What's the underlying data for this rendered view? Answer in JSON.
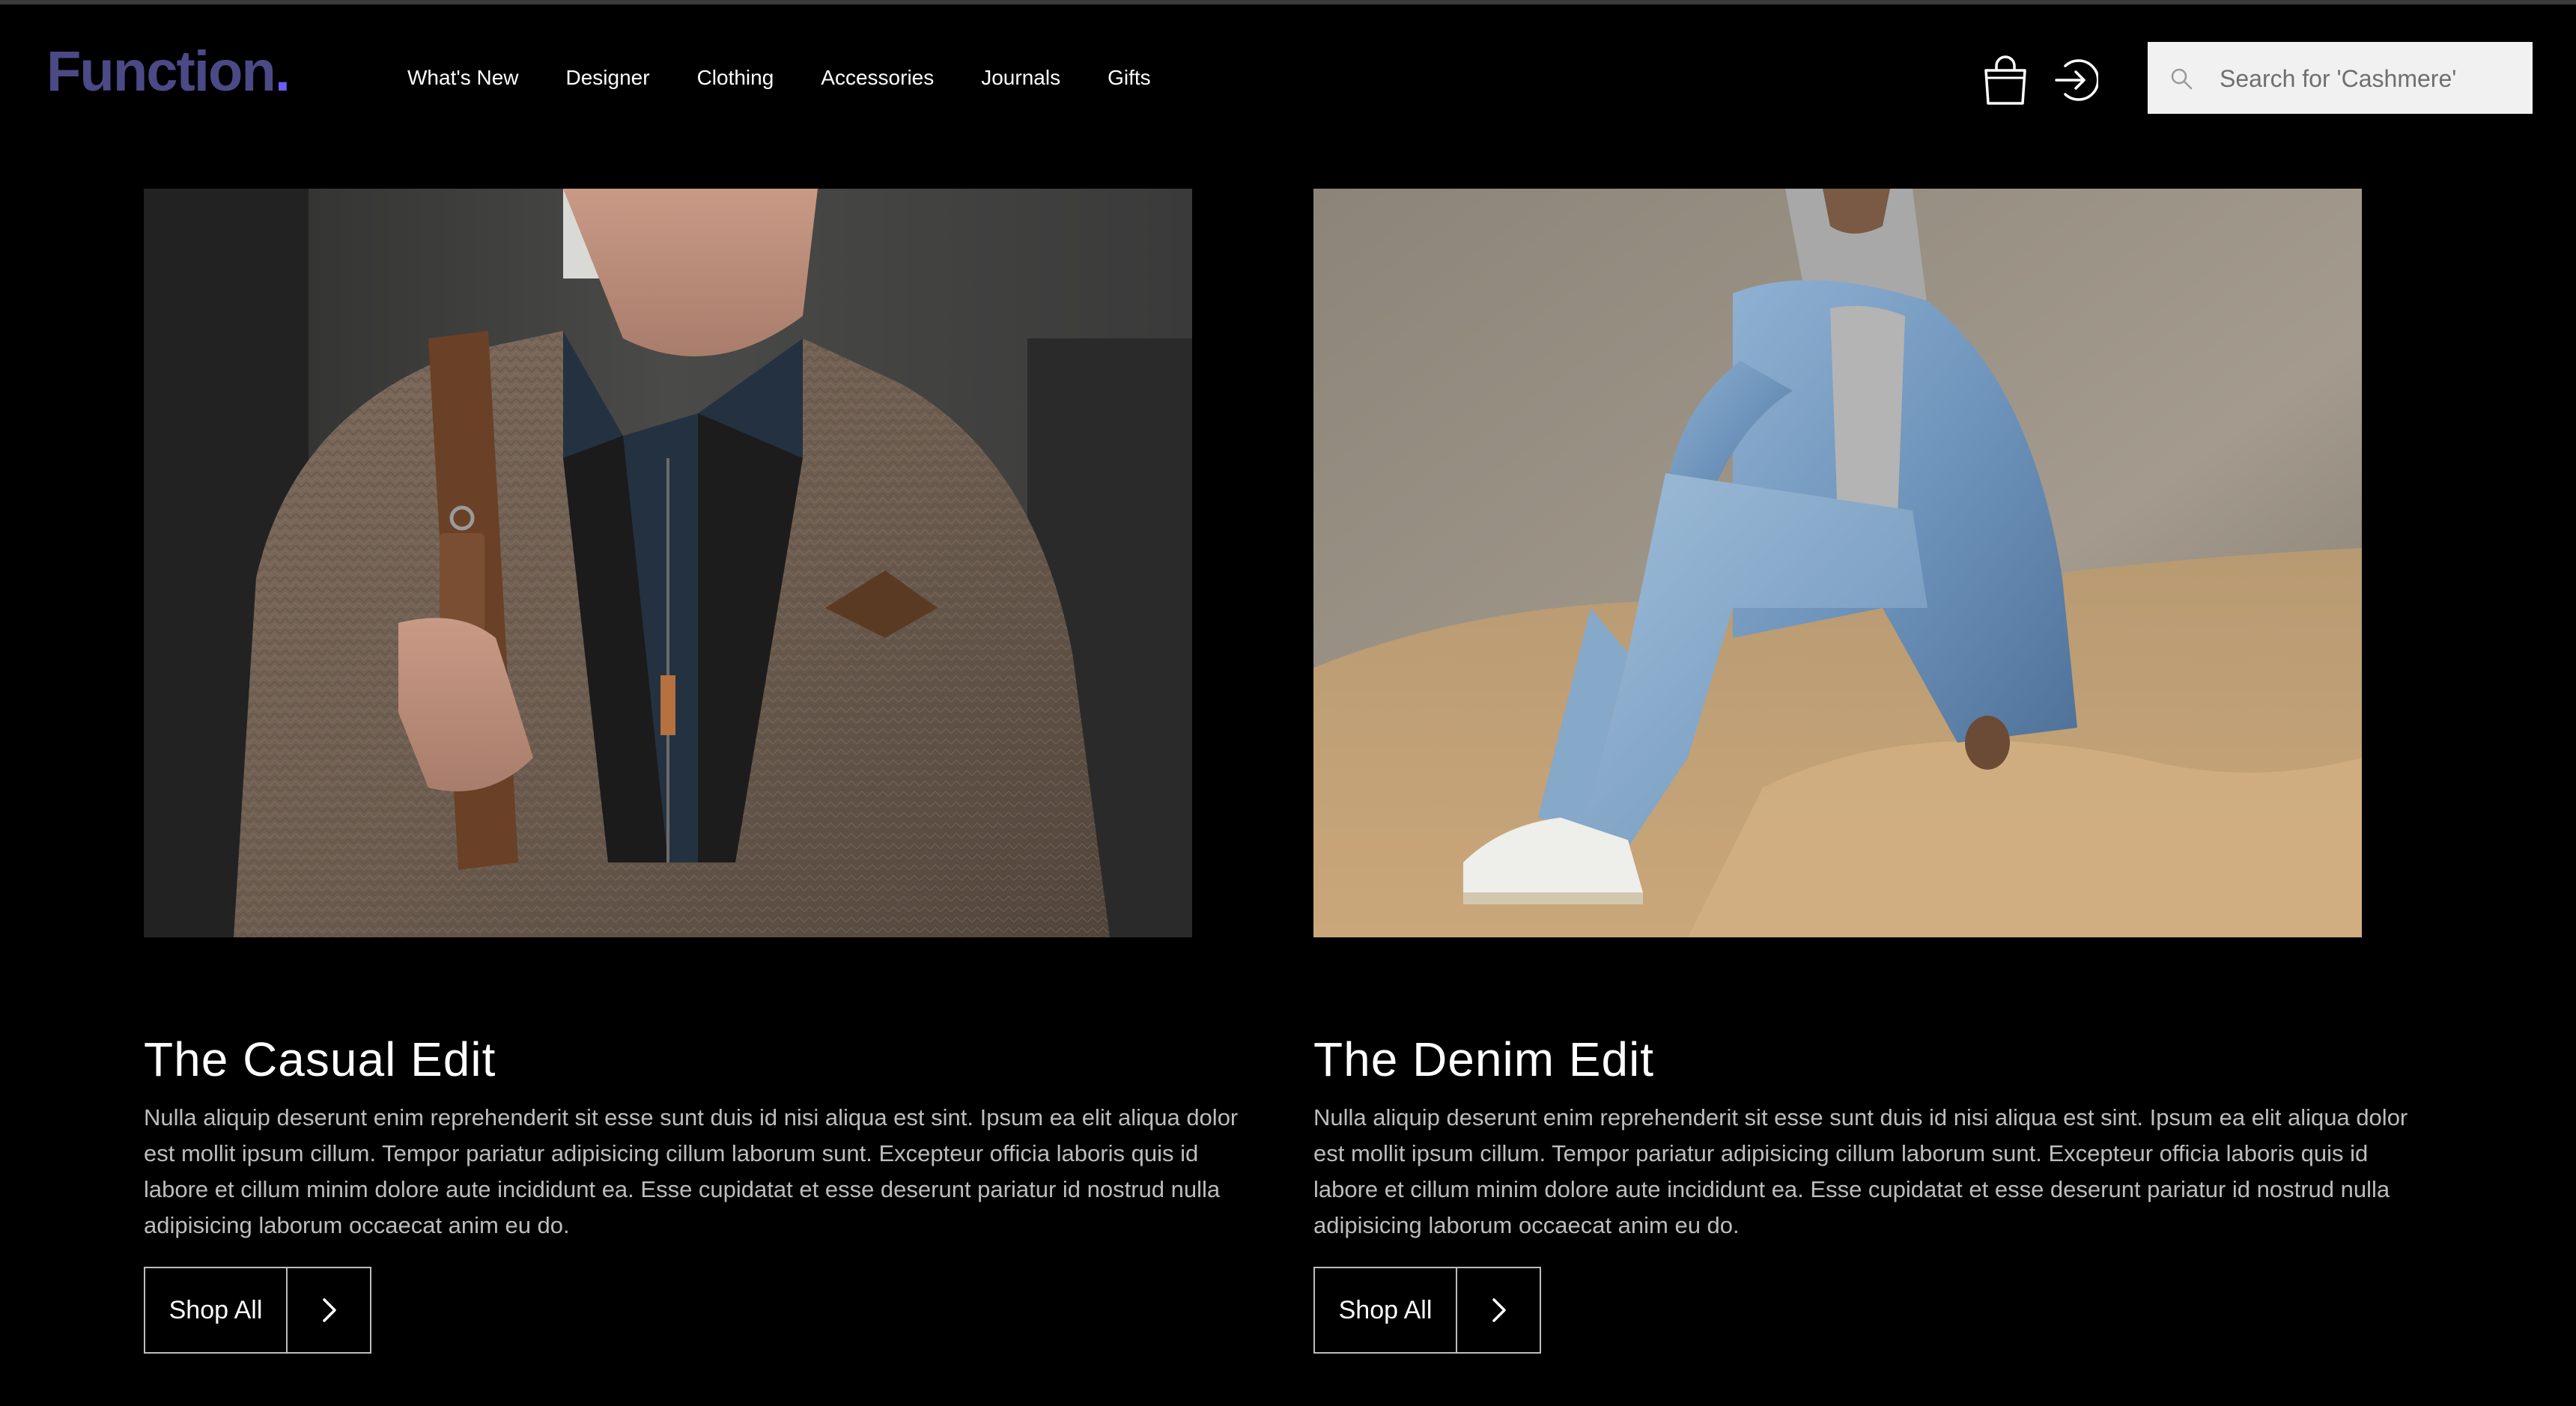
{
  "header": {
    "logo_text": "Function",
    "logo_dot": ".",
    "nav": [
      {
        "label": "What's New"
      },
      {
        "label": "Designer"
      },
      {
        "label": "Clothing"
      },
      {
        "label": "Accessories"
      },
      {
        "label": "Journals"
      },
      {
        "label": "Gifts"
      }
    ],
    "search": {
      "placeholder": "Search for 'Cashmere'",
      "value": ""
    }
  },
  "cards": [
    {
      "title": "The Casual Edit",
      "body": "Nulla aliquip deserunt enim reprehenderit sit esse sunt duis id nisi aliqua est sint. Ipsum ea elit aliqua dolor est mollit ipsum cillum. Tempor pariatur adipisicing cillum laborum sunt. Excepteur officia laboris quis id labore et cillum minim dolore aute incididunt ea. Esse cupidatat et esse deserunt pariatur id nostrud nulla adipisicing laborum occaecat anim eu do.",
      "button_label": "Shop All"
    },
    {
      "title": "The Denim Edit",
      "body": "Nulla aliquip deserunt enim reprehenderit sit esse sunt duis id nisi aliqua est sint. Ipsum ea elit aliqua dolor est mollit ipsum cillum. Tempor pariatur adipisicing cillum laborum sunt. Excepteur officia laboris quis id labore et cillum minim dolore aute incididunt ea. Esse cupidatat et esse deserunt pariatur id nostrud nulla adipisicing laborum occaecat anim eu do.",
      "button_label": "Shop All"
    }
  ],
  "colors": {
    "background": "#000000",
    "logo": "#4b4a86",
    "logo_dot": "#6d5cf6",
    "body_text": "#bdbdbd",
    "search_bg": "#f1f1f1"
  },
  "icons": {
    "cart": "shopping-bag-icon",
    "sign_in": "sign-in-arrow-icon",
    "search": "search-icon",
    "button_arrow": "chevron-right-icon"
  }
}
